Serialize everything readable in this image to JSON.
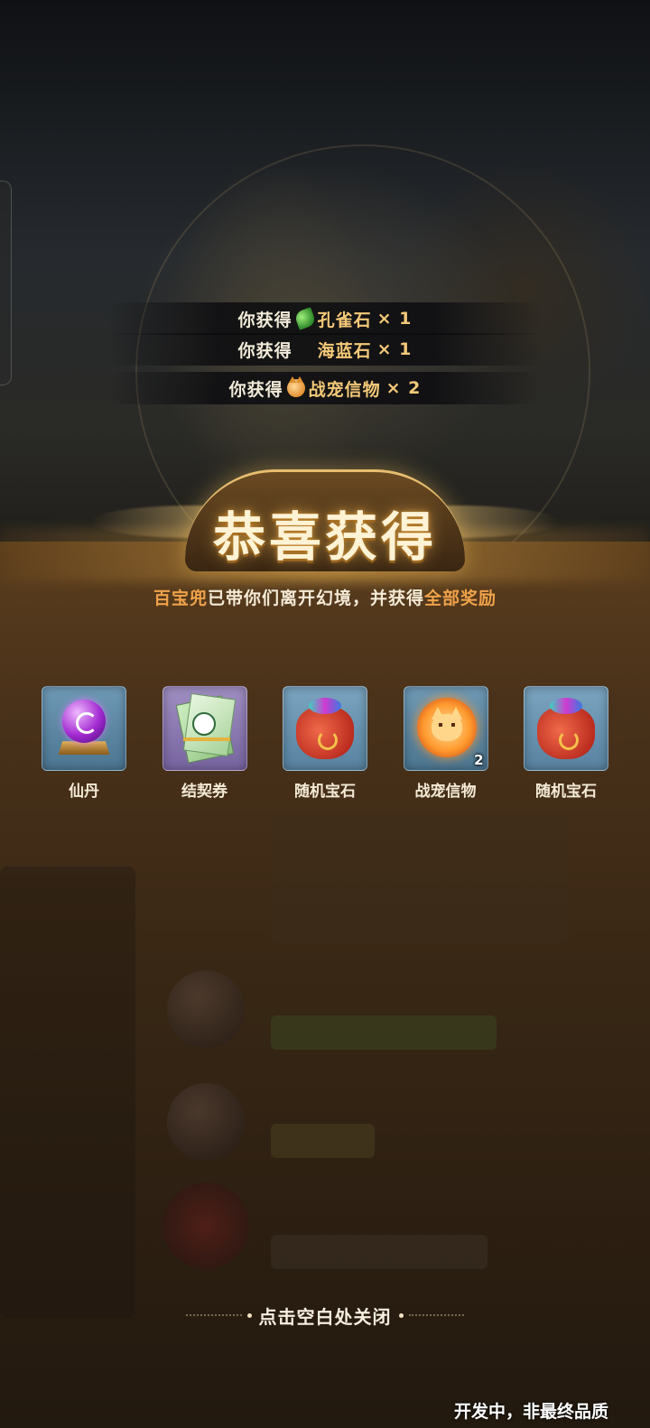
{
  "notifications": [
    {
      "prefix": "你获得",
      "icon": "peacock-stone-icon",
      "item": "孔雀石",
      "qty": "× 1"
    },
    {
      "prefix": "你获得",
      "icon": "aquamarine-icon",
      "item": "海蓝石",
      "qty": "× 1"
    },
    {
      "prefix": "你获得",
      "icon": "pet-token-icon",
      "item": "战宠信物",
      "qty": "× 2"
    }
  ],
  "banner": {
    "title": "恭喜获得"
  },
  "subtitle": {
    "highlight1": "百宝兜",
    "middle": "已带你们离开幻境，并获得",
    "highlight2": "全部奖励"
  },
  "rewards": [
    {
      "name": "仙丹",
      "icon": "elixir-orb-icon"
    },
    {
      "name": "结契券",
      "icon": "contract-ticket-icon"
    },
    {
      "name": "随机宝石",
      "icon": "gem-bag-icon"
    },
    {
      "name": "战宠信物",
      "icon": "pet-token-icon",
      "count": "2"
    },
    {
      "name": "随机宝石",
      "icon": "gem-bag-icon"
    }
  ],
  "close_hint": "点击空白处关闭",
  "watermark": "开发中，非最终品质",
  "colors": {
    "highlight": "#f0a24a",
    "item_text": "#f4c978",
    "panel": "#4a321a"
  }
}
